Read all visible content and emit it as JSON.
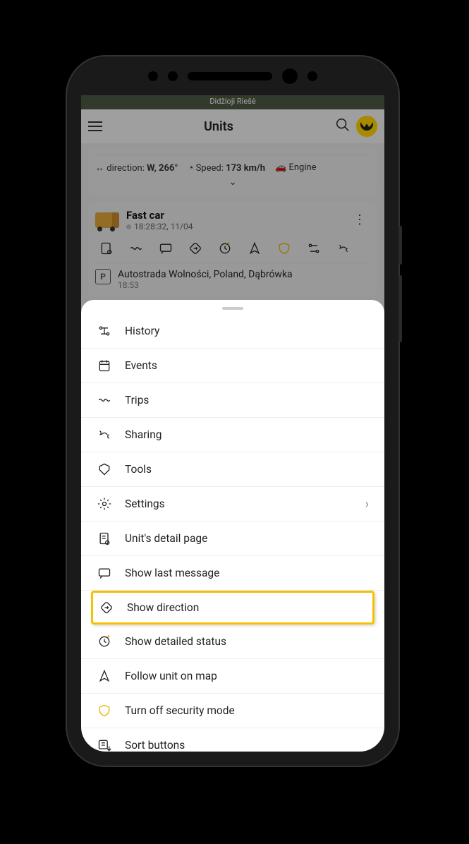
{
  "status_strip": "Didžioji Riešė",
  "topbar": {
    "title": "Units"
  },
  "card1": {
    "direction_label": "direction:",
    "direction_value": "W, 266°",
    "speed_label": "Speed:",
    "speed_value": "173 km/h",
    "engine_label": "Engine"
  },
  "unit": {
    "name": "Fast car",
    "time": "18:28:32, 11/04",
    "location": "Autostrada Wolności, Poland, Dąbrówka",
    "loc_time": "18:53",
    "park_icon": "P"
  },
  "menu": [
    {
      "icon": "history",
      "label": "History",
      "chevron": false,
      "highlight": false,
      "yellow": false
    },
    {
      "icon": "events",
      "label": "Events",
      "chevron": false,
      "highlight": false,
      "yellow": false
    },
    {
      "icon": "trips",
      "label": "Trips",
      "chevron": false,
      "highlight": false,
      "yellow": false
    },
    {
      "icon": "sharing",
      "label": "Sharing",
      "chevron": false,
      "highlight": false,
      "yellow": false
    },
    {
      "icon": "tools",
      "label": "Tools",
      "chevron": false,
      "highlight": false,
      "yellow": false
    },
    {
      "icon": "settings",
      "label": "Settings",
      "chevron": true,
      "highlight": false,
      "yellow": false
    },
    {
      "icon": "detail",
      "label": "Unit's detail page",
      "chevron": false,
      "highlight": false,
      "yellow": false
    },
    {
      "icon": "message",
      "label": "Show last message",
      "chevron": false,
      "highlight": false,
      "yellow": false
    },
    {
      "icon": "direction",
      "label": "Show direction",
      "chevron": false,
      "highlight": true,
      "yellow": false
    },
    {
      "icon": "status",
      "label": "Show detailed status",
      "chevron": false,
      "highlight": false,
      "yellow": false
    },
    {
      "icon": "follow",
      "label": "Follow unit on map",
      "chevron": false,
      "highlight": false,
      "yellow": false
    },
    {
      "icon": "security",
      "label": "Turn off security mode",
      "chevron": false,
      "highlight": false,
      "yellow": true
    },
    {
      "icon": "sort",
      "label": "Sort buttons",
      "chevron": false,
      "highlight": false,
      "yellow": false
    }
  ]
}
